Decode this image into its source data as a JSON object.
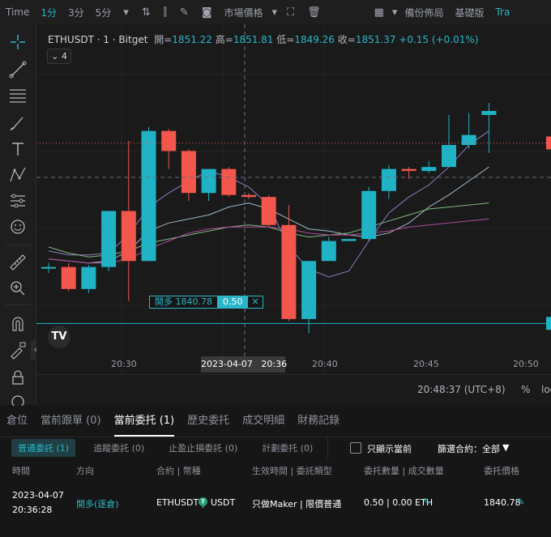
{
  "topbar": {
    "time_label": "Time",
    "intervals": [
      "1分",
      "3分",
      "5分"
    ],
    "order_type": "市場價格",
    "layout": "備份佈局",
    "basic": "基礎版",
    "trade": "Tra"
  },
  "legend": {
    "symbol": "ETHUSDT · 1 · Bitget",
    "open_label": "開=",
    "open": "1851.22",
    "high_label": "高=",
    "high": "1851.81",
    "low_label": "低=",
    "low": "1849.26",
    "close_label": "收=",
    "close": "1851.37",
    "change": "+0.15 (+0.01%)",
    "collapsed_count": "4"
  },
  "chart_data": {
    "type": "candlestick",
    "x_ticks": [
      "20:30",
      "20:40",
      "20:45",
      "20:50"
    ],
    "crosshair_time": "2023-04-07   20:36",
    "time_readout": "20:48:37 (UTC+8)",
    "percent_btn": "%",
    "log_btn": "log",
    "candles": [
      {
        "o": 1843.6,
        "h": 1843.8,
        "l": 1843.3,
        "c": 1843.6
      },
      {
        "o": 1843.6,
        "h": 1843.8,
        "l": 1842.4,
        "c": 1842.5
      },
      {
        "o": 1842.5,
        "h": 1843.7,
        "l": 1842.3,
        "c": 1843.6
      },
      {
        "o": 1843.6,
        "h": 1846.4,
        "l": 1843.4,
        "c": 1846.4
      },
      {
        "o": 1846.4,
        "h": 1849.9,
        "l": 1841.9,
        "c": 1843.9
      },
      {
        "o": 1843.9,
        "h": 1850.6,
        "l": 1843.9,
        "c": 1850.4
      },
      {
        "o": 1850.4,
        "h": 1850.5,
        "l": 1848.5,
        "c": 1849.4
      },
      {
        "o": 1849.4,
        "h": 1849.5,
        "l": 1846.9,
        "c": 1847.3
      },
      {
        "o": 1847.3,
        "h": 1848.5,
        "l": 1846.9,
        "c": 1848.5
      },
      {
        "o": 1848.5,
        "h": 1848.6,
        "l": 1847.1,
        "c": 1847.2
      },
      {
        "o": 1847.2,
        "h": 1847.3,
        "l": 1847.0,
        "c": 1847.1
      },
      {
        "o": 1847.1,
        "h": 1847.2,
        "l": 1845.6,
        "c": 1845.7
      },
      {
        "o": 1845.7,
        "h": 1846.7,
        "l": 1840.9,
        "c": 1841.0
      },
      {
        "o": 1841.0,
        "h": 1843.9,
        "l": 1840.3,
        "c": 1843.9
      },
      {
        "o": 1843.9,
        "h": 1845.1,
        "l": 1843.9,
        "c": 1844.9
      },
      {
        "o": 1844.9,
        "h": 1845.0,
        "l": 1844.9,
        "c": 1845.0
      },
      {
        "o": 1845.0,
        "h": 1847.6,
        "l": 1844.9,
        "c": 1847.4
      },
      {
        "o": 1847.4,
        "h": 1848.7,
        "l": 1847.0,
        "c": 1848.5
      },
      {
        "o": 1848.5,
        "h": 1848.6,
        "l": 1848.0,
        "c": 1848.4
      },
      {
        "o": 1848.4,
        "h": 1848.9,
        "l": 1848.3,
        "c": 1848.6
      },
      {
        "o": 1848.6,
        "h": 1851.2,
        "l": 1848.6,
        "c": 1849.7
      },
      {
        "o": 1849.7,
        "h": 1851.3,
        "l": 1849.5,
        "c": 1850.2
      },
      {
        "o": 1851.2,
        "h": 1851.8,
        "l": 1849.3,
        "c": 1851.4
      }
    ],
    "current_price": 1849.8,
    "ma_lines": [
      {
        "color": "#8e7cc3",
        "values": [
          1844.4,
          1844.2,
          1844.2,
          1844.3,
          1845.2,
          1846.6,
          1847.3,
          1847.9,
          1848.4,
          1848.1,
          1847.6,
          1846.7,
          1844.6,
          1843.5,
          1843.1,
          1843.4,
          1844.9,
          1846.3,
          1847.1,
          1847.7,
          1848.6,
          1849.7,
          1850.4
        ]
      },
      {
        "color": "#9eb8c8",
        "values": [
          1844.0,
          1843.9,
          1843.8,
          1843.9,
          1844.4,
          1845.4,
          1845.8,
          1846.0,
          1846.2,
          1846.6,
          1846.8,
          1846.5,
          1846.0,
          1845.5,
          1845.4,
          1845.2,
          1845.1,
          1845.3,
          1845.8,
          1846.6,
          1847.2,
          1847.9,
          1848.6
        ]
      },
      {
        "color": "#7fb87f",
        "values": [
          1844.6,
          1844.3,
          1844.1,
          1844.2,
          1844.4,
          1844.8,
          1845.0,
          1845.2,
          1845.4,
          1845.6,
          1845.7,
          1845.6,
          1845.3,
          1845.1,
          1845.2,
          1845.3,
          1845.6,
          1845.9,
          1846.2,
          1846.5,
          1846.6,
          1846.7,
          1846.8
        ]
      },
      {
        "color": "#b04b9d",
        "values": [
          1844.0,
          1843.9,
          1843.8,
          1843.8,
          1844.0,
          1844.5,
          1844.9,
          1845.3,
          1845.5,
          1845.6,
          1845.6,
          1845.6,
          1845.5,
          1845.3,
          1845.2,
          1845.2,
          1845.3,
          1845.4,
          1845.6,
          1845.7,
          1845.8,
          1845.9,
          1846.0
        ]
      }
    ],
    "ylim": [
      1838.2,
      1852.3
    ],
    "order_line": {
      "label": "開多 1840.78",
      "qty": "0.50",
      "price": 1840.78
    }
  },
  "tabs": [
    "倉位",
    "當前跟單 (0)",
    "當前委托 (1)",
    "歷史委托",
    "成交明細",
    "財務記錄"
  ],
  "subtabs": [
    "普通委託 (1)",
    "追蹤委託 (0)",
    "止盈止損委託 (0)",
    "計劃委托 (0)"
  ],
  "filter": {
    "current_only": "只顯示當前",
    "contract": "篩選合約：全部"
  },
  "columns": [
    "時間",
    "方向",
    "合約 | 幣種",
    "生效時間 | 委託類型",
    "委托數量 | 成交數量",
    "委托價格"
  ],
  "row": {
    "date": "2023-04-07",
    "time": "20:36:28",
    "direction": "開多(逐倉)",
    "contract": "ETHUSDT |",
    "coin": "USDT",
    "validity": "只做Maker | 限價普通",
    "qty": "0.50 | 0.00 ETH",
    "price": "1840.78"
  }
}
